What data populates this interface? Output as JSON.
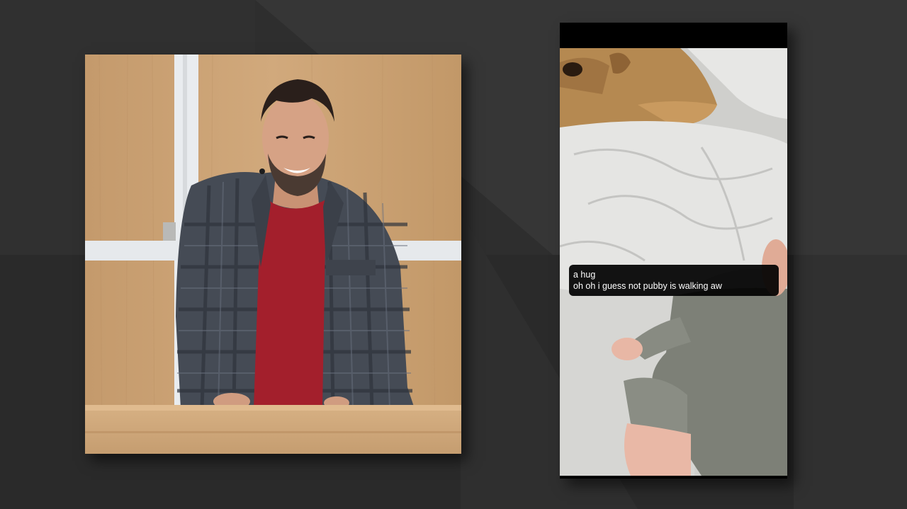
{
  "caption": {
    "lines": [
      "a hug",
      "oh oh i guess not pubby is walking aw"
    ]
  },
  "colors": {
    "background": "#2c2c2c",
    "caption_bg": "#000000",
    "caption_text": "#ffffff"
  }
}
